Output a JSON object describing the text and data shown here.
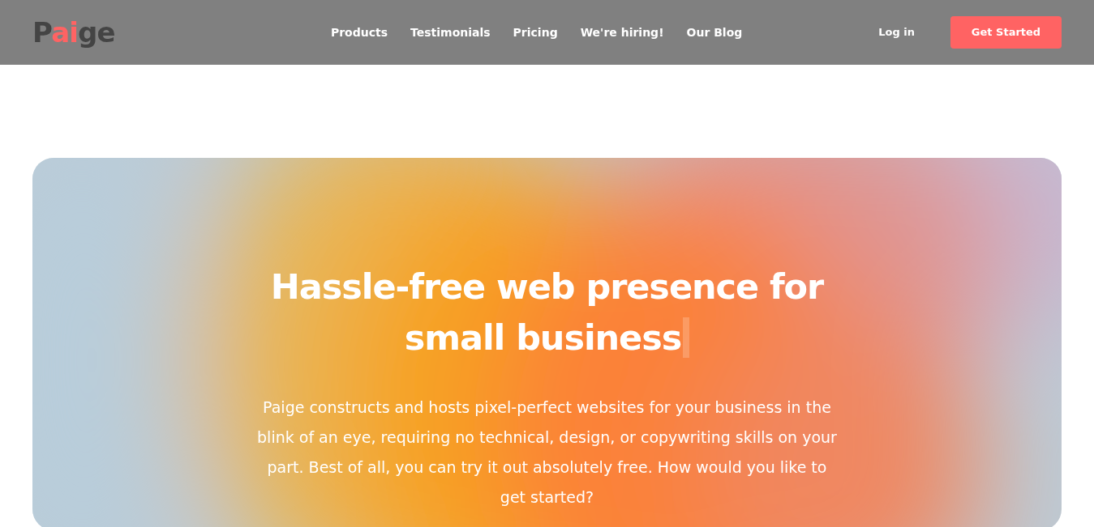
{
  "header": {
    "logo": [
      {
        "text": "P",
        "accent": false
      },
      {
        "text": "ai",
        "accent": true
      },
      {
        "text": "ge",
        "accent": false
      }
    ],
    "nav": [
      "Products",
      "Testimonials",
      "Pricing",
      "We're hiring!",
      "Our Blog"
    ],
    "login": "Log in",
    "cta": "Get Started"
  },
  "hero": {
    "kind": "picture",
    "title": "Hassle-free web presence for small business",
    "cursor": true,
    "text": "Paige constructs and hosts pixel-perfect websites for your business in the blink of an eye, requiring no technical, design, or copywriting skills on your part. Best of all, you can try it out absolutely free. How would you like to get started?"
  }
}
